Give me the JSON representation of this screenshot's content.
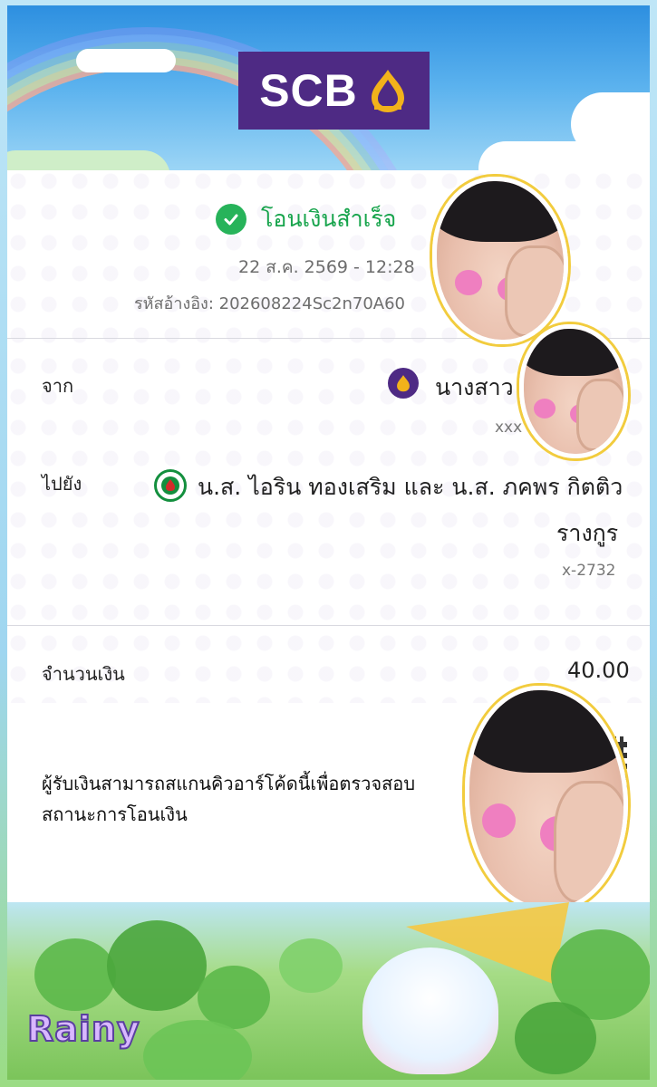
{
  "brand": {
    "logo_text": "SCB",
    "logo_bg": "#4e2a84"
  },
  "status": {
    "icon": "check-circle-icon",
    "text": "โอนเงินสำเร็จ",
    "color": "#17a44c"
  },
  "datetime": "22 ส.ค. 2569 - 12:28",
  "reference": {
    "label": "รหัสอ้างอิง:",
    "value": "202608224Sc2n70A60"
  },
  "from": {
    "label": "จาก",
    "bank_icon": "scb-bank-icon",
    "name": "นางสาว",
    "account": "xxx"
  },
  "to": {
    "label": "ไปยัง",
    "bank_icon": "kbank-bank-icon",
    "name_line1": "น.ส. ไอริน ทองเสริม และ น.ส. ภคพร กิตติว",
    "name_line2": "รางกูร",
    "account": "x-2732"
  },
  "amount": {
    "label": "จำนวนเงิน",
    "value": "40.00"
  },
  "qr_note": "ผู้รับเงินสามารถสแกนคิวอาร์โค้ดนี้เพื่อตรวจสอบสถานะการโอนเงิน",
  "footer": {
    "brand_text": "Rainy"
  }
}
